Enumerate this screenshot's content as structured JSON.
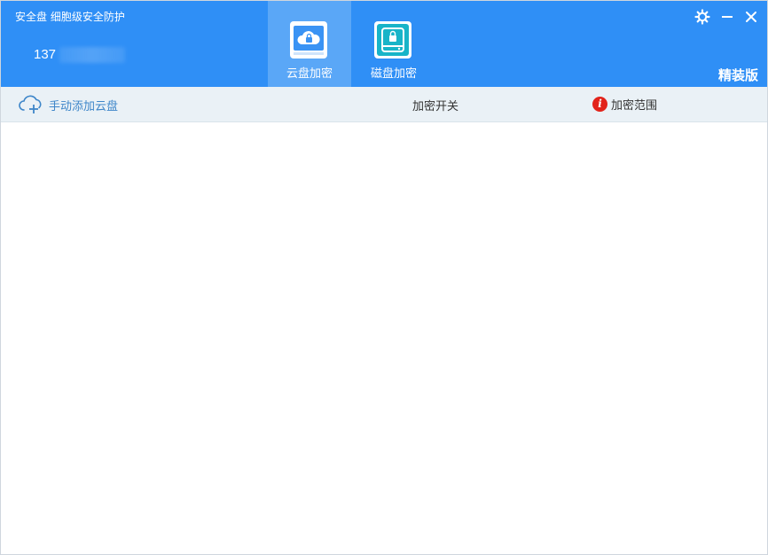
{
  "app": {
    "title": "安全盘 细胞级安全防护",
    "account": "137",
    "edition": "精装版"
  },
  "tabs": [
    {
      "label": "云盘加密",
      "icon": "cloud-lock-icon",
      "active": true
    },
    {
      "label": "磁盘加密",
      "icon": "disk-lock-icon",
      "active": false
    }
  ],
  "toolbar": {
    "add_cloud_label": "手动添加云盘",
    "encrypt_switch_label": "加密开关",
    "encrypt_scope_label": "加密范围",
    "info_glyph": "i"
  },
  "colors": {
    "header_bg": "#2f8ff6",
    "tab_active_bg": "#5aa7f7",
    "toolbar_bg": "#eaf1f6",
    "link": "#3e86c9",
    "info_red": "#e2231a"
  }
}
